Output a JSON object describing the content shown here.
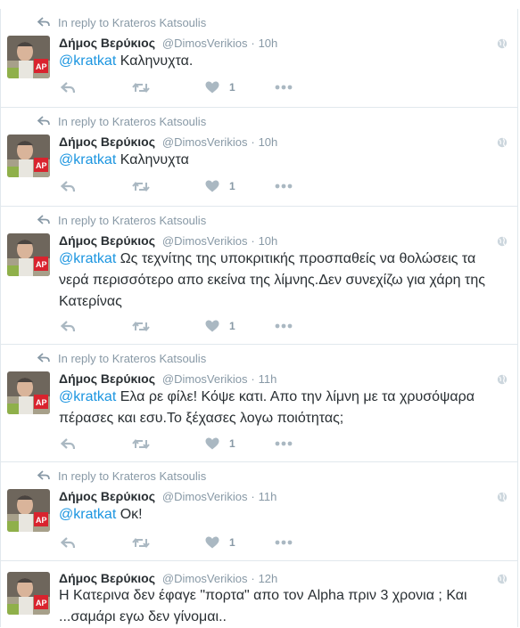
{
  "colors": {
    "accent": "#1b95e0",
    "muted": "#8899a6",
    "text": "#292f33",
    "border": "#e1e8ed"
  },
  "icons": {
    "reply": "reply-arrow-icon",
    "retweet": "retweet-icon",
    "like": "heart-icon",
    "more": "more-dots-icon",
    "globe": "globe-icon"
  },
  "tweets": [
    {
      "reply_to": "In reply to Krateros Katsoulis",
      "author": "Δήμος Βερύκιος",
      "handle": "@DimosVerikios",
      "sep": "·",
      "time": "10h",
      "mention": "@kratkat",
      "body": " Καληνυχτα.",
      "likes": "1"
    },
    {
      "reply_to": "In reply to Krateros Katsoulis",
      "author": "Δήμος Βερύκιος",
      "handle": "@DimosVerikios",
      "sep": "·",
      "time": "10h",
      "mention": "@kratkat",
      "body": " Καληνυχτα",
      "likes": "1"
    },
    {
      "reply_to": "In reply to Krateros Katsoulis",
      "author": "Δήμος Βερύκιος",
      "handle": "@DimosVerikios",
      "sep": "·",
      "time": "10h",
      "mention": "@kratkat",
      "body": " Ως τεχνίτης της υποκριτικής προσπαθείς να θολώσεις τα νερά περισσότερο απο εκείνα της λίμνης.Δεν συνεχίζω για χάρη της Κατερίνας",
      "likes": "1"
    },
    {
      "reply_to": "In reply to Krateros Katsoulis",
      "author": "Δήμος Βερύκιος",
      "handle": "@DimosVerikios",
      "sep": "·",
      "time": "11h",
      "mention": "@kratkat",
      "body": " Ελα ρε φίλε! Κόψε κατι. Απο την λίμνη με τα χρυσόψαρα πέρασες και εσυ.Το ξέχασες λογω ποιότητας;",
      "likes": "1"
    },
    {
      "reply_to": "In reply to Krateros Katsoulis",
      "author": "Δήμος Βερύκιος",
      "handle": "@DimosVerikios",
      "sep": "·",
      "time": "11h",
      "mention": "@kratkat",
      "body": " Οκ!",
      "likes": "1"
    },
    {
      "reply_to": "",
      "author": "Δήμος Βερύκιος",
      "handle": "@DimosVerikios",
      "sep": "·",
      "time": "12h",
      "mention": "",
      "body": "Η Κατερινα δεν έφαγε \"πορτα\" απο τον Alpha πριν 3 χρονια ; Και ...σαμάρι εγω δεν γίνομαι..",
      "likes": ""
    }
  ]
}
